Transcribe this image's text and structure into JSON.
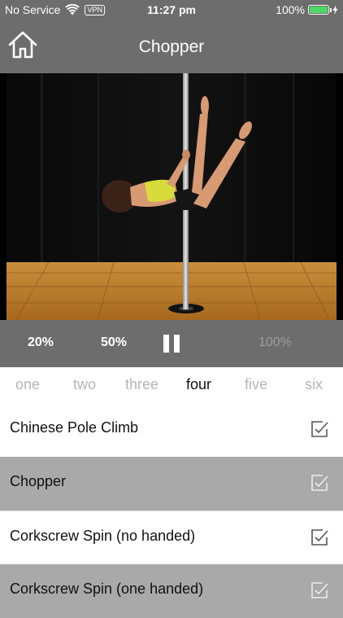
{
  "status_bar": {
    "carrier": "No Service",
    "vpn": "VPN",
    "time": "11:27 pm",
    "battery_percent": "100%",
    "battery_level": 1.0,
    "battery_color": "#4cd964"
  },
  "nav": {
    "title": "Chopper",
    "home_icon": "home-icon"
  },
  "video": {
    "description_icon": "video-frame"
  },
  "controls": {
    "speed_20": "20%",
    "speed_50": "50%",
    "speed_100": "100%",
    "pause_icon": "pause-icon"
  },
  "levels": {
    "tabs": [
      {
        "label": "one",
        "active": false
      },
      {
        "label": "two",
        "active": false
      },
      {
        "label": "three",
        "active": false
      },
      {
        "label": "four",
        "active": true
      },
      {
        "label": "five",
        "active": false
      },
      {
        "label": "six",
        "active": false
      }
    ]
  },
  "moves": [
    {
      "label": "Chinese Pole Climb",
      "checked": true,
      "shade": "light"
    },
    {
      "label": "Chopper",
      "checked": true,
      "shade": "dark"
    },
    {
      "label": "Corkscrew Spin (no handed)",
      "checked": true,
      "shade": "light"
    },
    {
      "label": "Corkscrew Spin (one handed)",
      "checked": true,
      "shade": "dark"
    }
  ],
  "colors": {
    "bar_gray": "#6d6d6d",
    "row_dark": "#a9a9a9",
    "tab_inactive": "#b6b6b6",
    "tab_active": "#111111"
  }
}
